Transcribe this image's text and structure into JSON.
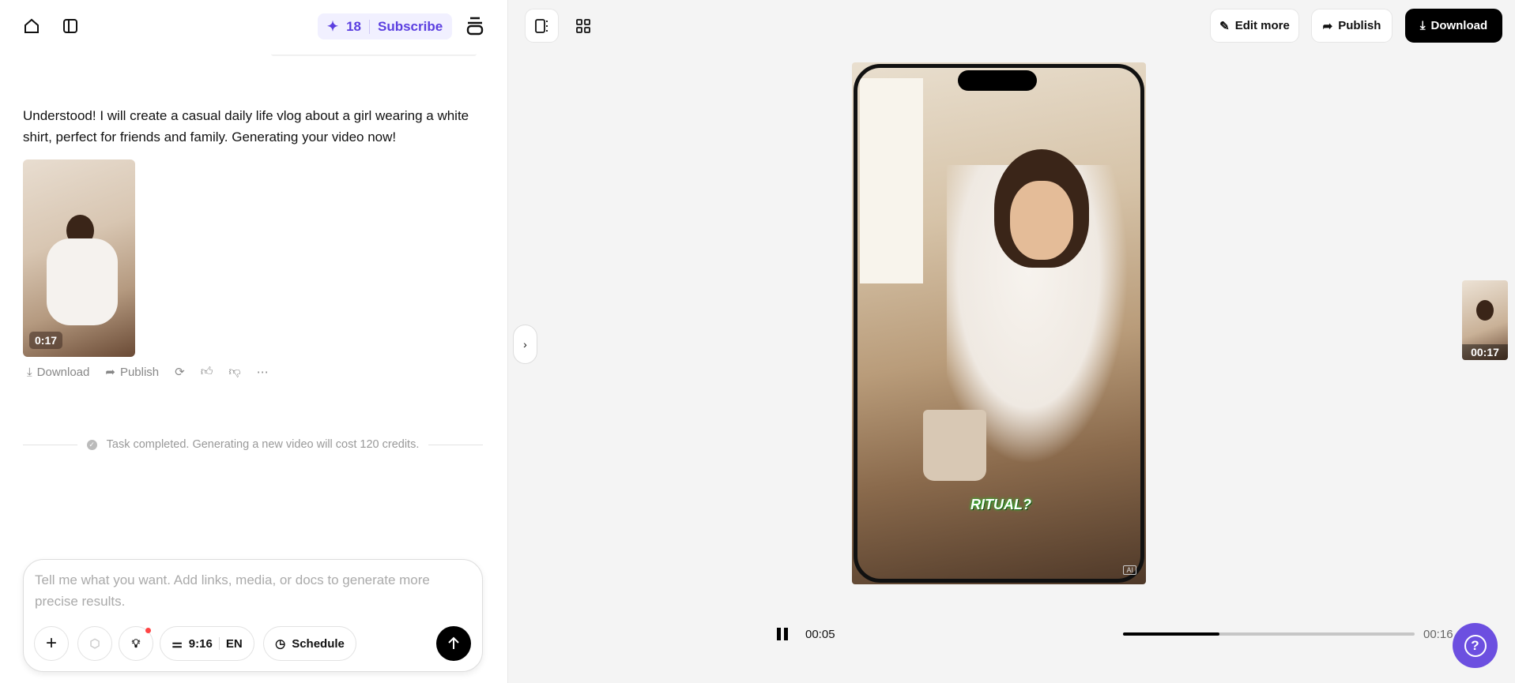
{
  "header": {
    "credits": "18",
    "subscribe_label": "Subscribe"
  },
  "chat": {
    "assistant_message": "Understood! I will create a casual daily life vlog about a girl wearing a white shirt, perfect for friends and family. Generating your video now!",
    "video_thumb": {
      "duration": "0:17"
    },
    "actions": {
      "download": "Download",
      "publish": "Publish"
    },
    "status": "Task completed. Generating a new video will cost 120 credits."
  },
  "composer": {
    "placeholder": "Tell me what you want. Add links, media, or docs to generate more precise results.",
    "aspect": "9:16",
    "language": "EN",
    "schedule_label": "Schedule"
  },
  "toolbar": {
    "edit_more": "Edit more",
    "publish": "Publish",
    "download": "Download"
  },
  "player": {
    "caption": "RITUAL?",
    "current_time": "00:05",
    "total_time": "00:16",
    "progress_percent": 33,
    "ai_badge": "AI"
  },
  "side_thumb": {
    "duration": "00:17"
  },
  "colors": {
    "accent": "#6c4fe0",
    "subscribe_bg": "#f1f0ff",
    "dark": "#000000"
  }
}
